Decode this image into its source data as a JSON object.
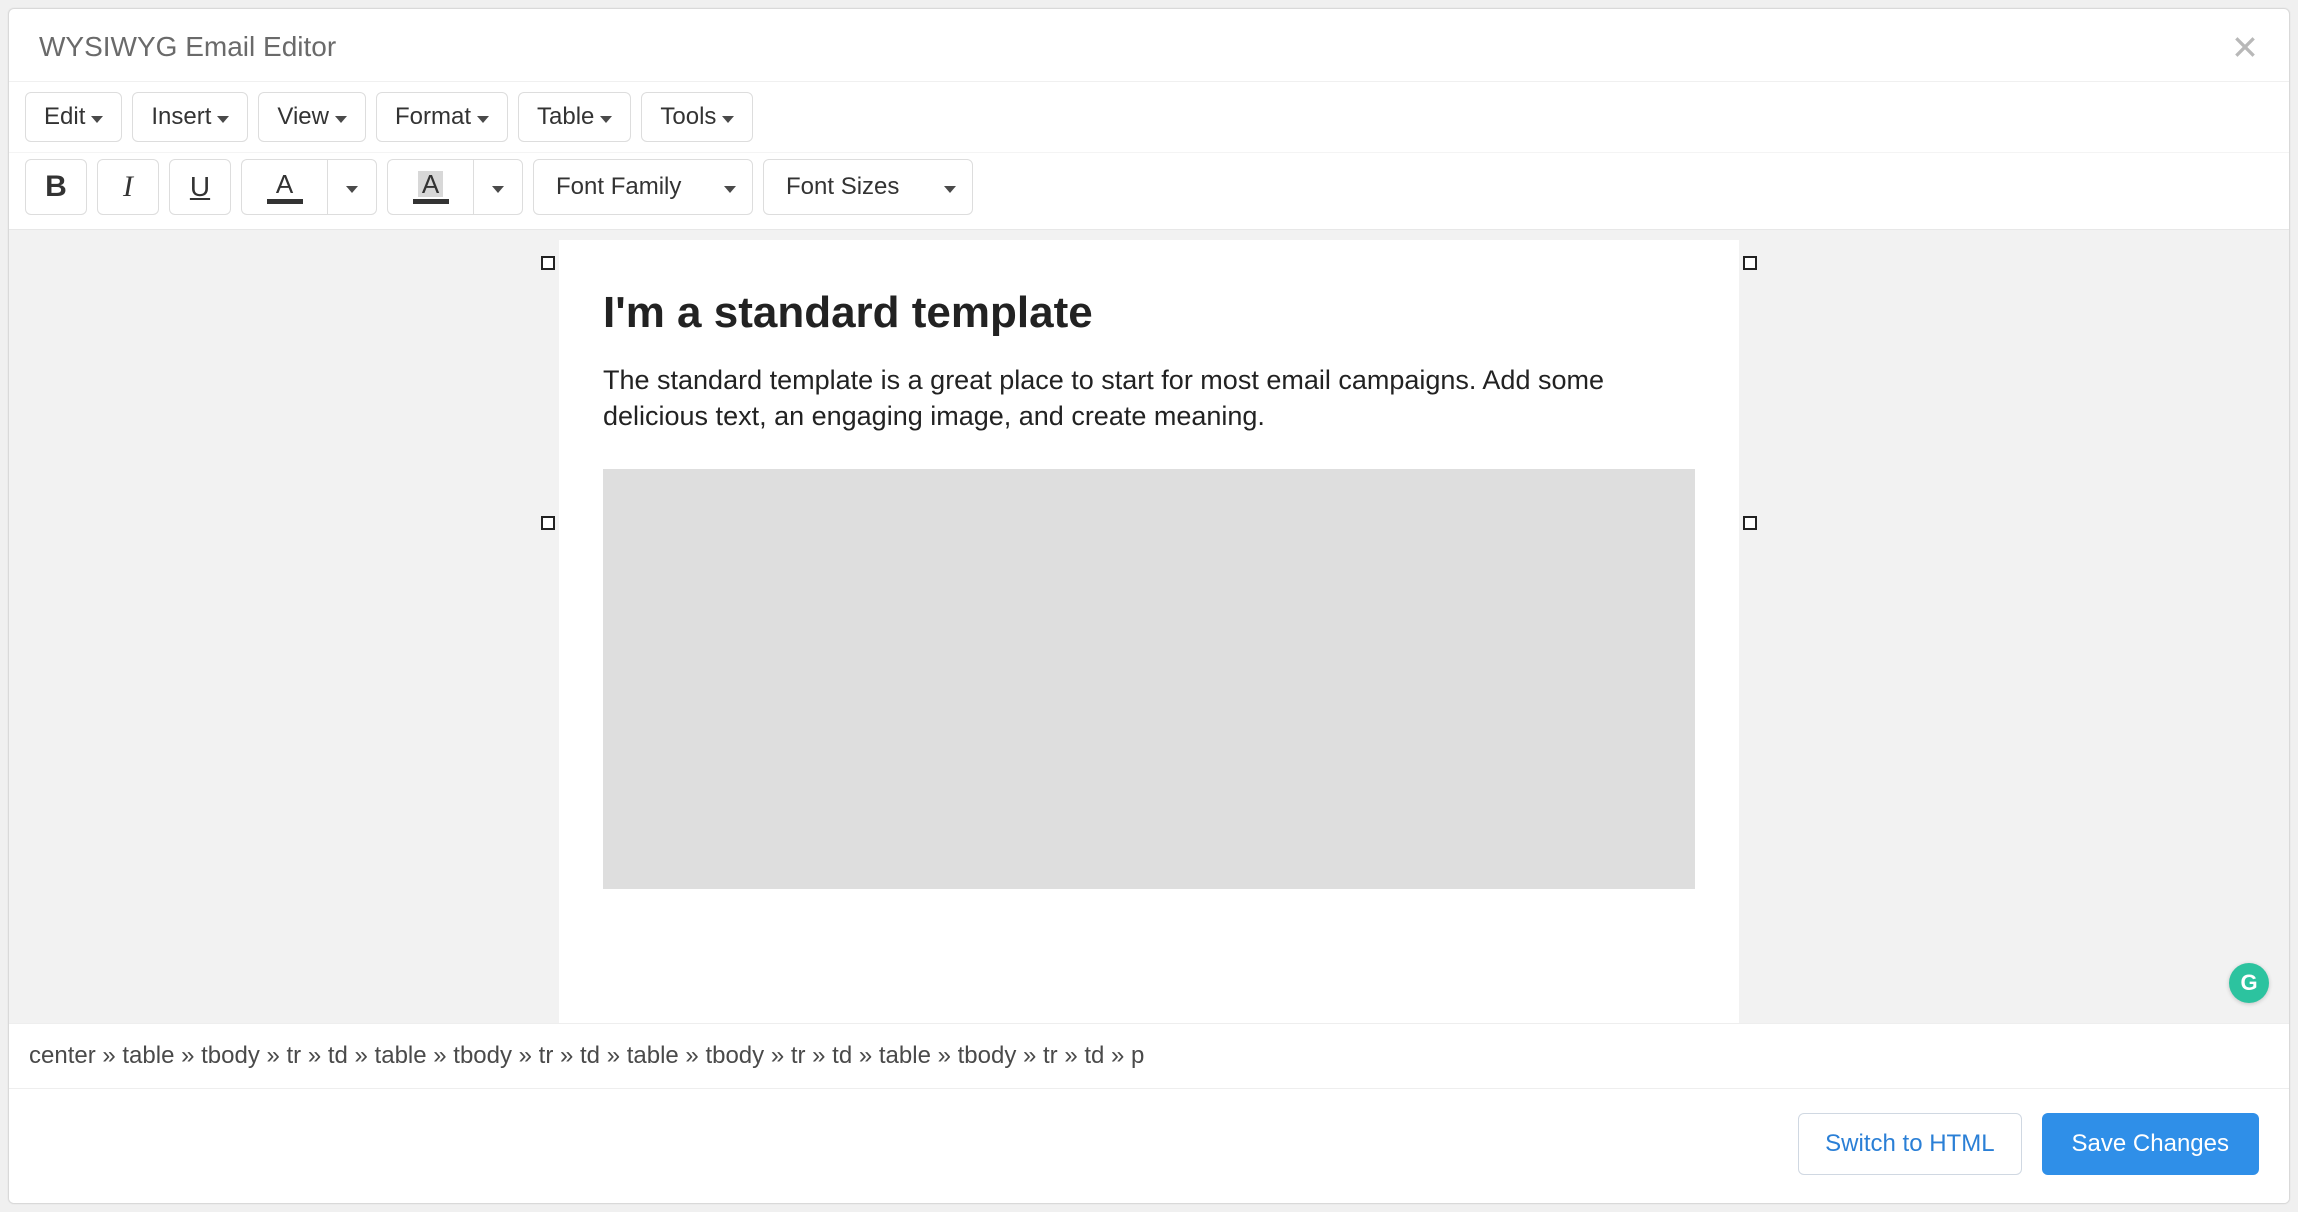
{
  "header": {
    "title": "WYSIWYG Email Editor"
  },
  "menubar": {
    "items": [
      "Edit",
      "Insert",
      "View",
      "Format",
      "Table",
      "Tools"
    ]
  },
  "toolbar": {
    "bold_glyph": "B",
    "italic_glyph": "I",
    "underline_glyph": "U",
    "textcolor_letter": "A",
    "bgcolor_letter": "A",
    "font_family_label": "Font Family",
    "font_sizes_label": "Font Sizes"
  },
  "document": {
    "heading": "I'm a standard template",
    "paragraph": "The standard template is a great place to start for most email campaigns. Add some delicious text, an engaging image, and create meaning."
  },
  "path": "center » table » tbody » tr » td » table » tbody » tr » td » table » tbody » tr » td » table » tbody » tr » td » p",
  "footer": {
    "switch_label": "Switch to HTML",
    "save_label": "Save Changes"
  },
  "grammarly_glyph": "G"
}
